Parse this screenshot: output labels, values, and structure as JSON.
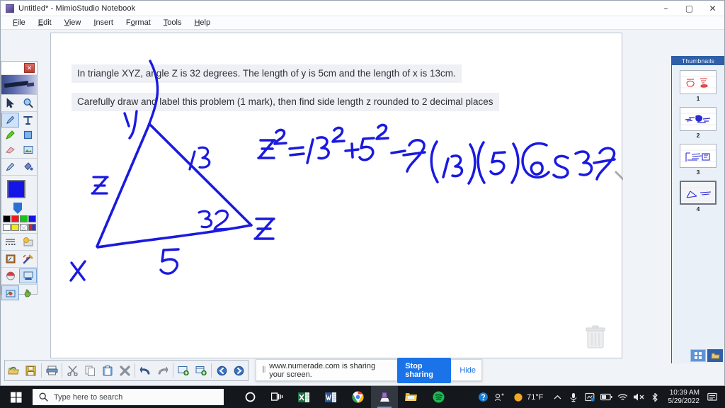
{
  "window": {
    "title": "Untitled* - MimioStudio Notebook",
    "icon": "notebook-icon",
    "controls": {
      "minimize": "–",
      "maximize": "▢",
      "close": "✕"
    }
  },
  "menu": {
    "items": [
      {
        "label": "File",
        "accel": "F"
      },
      {
        "label": "Edit",
        "accel": "E"
      },
      {
        "label": "View",
        "accel": "V"
      },
      {
        "label": "Insert",
        "accel": "I"
      },
      {
        "label": "Format",
        "accel": "o"
      },
      {
        "label": "Tools",
        "accel": "T"
      },
      {
        "label": "Help",
        "accel": "H"
      }
    ]
  },
  "canvas": {
    "prompt_line_1": "In triangle XYZ, angle Z is 32 degrees. The length of y is 5cm and the length of x is 13cm.",
    "prompt_line_2": "Carefully draw and label this problem (1 mark), then find side length z rounded to 2 decimal places",
    "ink_color": "#1a1ae0",
    "annotations": {
      "vertex_top": "Y",
      "vertex_bottom_left": "X",
      "vertex_right": "Z",
      "side_left": "z",
      "side_right": "13",
      "side_bottom": "5",
      "angle": "32",
      "equation": "z² = 13² + 5² - 2(13)(5)Cos 32"
    },
    "trash_icon": "trash-icon"
  },
  "tool_panel": {
    "close_label": "✕",
    "tools": [
      {
        "name": "select-tool",
        "label": "Select",
        "selected": false
      },
      {
        "name": "zoom-tool",
        "label": "Zoom",
        "selected": false
      },
      {
        "name": "pen-tool",
        "label": "Pen",
        "selected": true
      },
      {
        "name": "text-tool",
        "label": "Text",
        "selected": false
      },
      {
        "name": "highlighter-tool",
        "label": "Highlighter",
        "selected": false
      },
      {
        "name": "shape-tool",
        "label": "Shape",
        "selected": false
      },
      {
        "name": "eraser-tool",
        "label": "Eraser",
        "selected": false
      },
      {
        "name": "image-tool",
        "label": "Image",
        "selected": false
      },
      {
        "name": "marker-tool",
        "label": "Marker",
        "selected": false
      },
      {
        "name": "fill-tool",
        "label": "Fill",
        "selected": false
      },
      {
        "name": "gallery-tool",
        "label": "Gallery",
        "selected": false
      },
      {
        "name": "flash-tool",
        "label": "Flash Object",
        "selected": false
      },
      {
        "name": "screen-annotation-tool",
        "label": "Screen Annotation",
        "selected": false
      },
      {
        "name": "spotlight-tool",
        "label": "Spotlight",
        "selected": false
      },
      {
        "name": "reveal-tool",
        "label": "Reveal",
        "selected": false
      },
      {
        "name": "record-tool",
        "label": "Record",
        "selected": true
      },
      {
        "name": "capture-tool",
        "label": "Capture",
        "selected": true
      },
      {
        "name": "gesture-tool",
        "label": "Gesture",
        "selected": false
      }
    ],
    "current_color": "#1414e6",
    "palette_row_1": [
      "#000000",
      "#ee1c1c",
      "#16c416",
      "#1414e6"
    ],
    "palette_row_2": [
      "#ffffff",
      "#f5e71b",
      "transparent",
      "multicolor"
    ]
  },
  "bottom_toolbar": {
    "buttons": [
      {
        "name": "open-button",
        "label": "Open"
      },
      {
        "name": "save-button",
        "label": "Save"
      },
      {
        "name": "print-button",
        "label": "Print"
      },
      {
        "name": "cut-button",
        "label": "Cut"
      },
      {
        "name": "copy-button",
        "label": "Copy"
      },
      {
        "name": "paste-button",
        "label": "Paste"
      },
      {
        "name": "delete-button",
        "label": "Delete"
      },
      {
        "name": "undo-button",
        "label": "Undo"
      },
      {
        "name": "redo-button",
        "label": "Redo"
      },
      {
        "name": "new-page-button",
        "label": "New Page"
      },
      {
        "name": "duplicate-page-button",
        "label": "Duplicate Page"
      },
      {
        "name": "previous-page-button",
        "label": "Previous Page"
      },
      {
        "name": "next-page-button",
        "label": "Next Page"
      }
    ]
  },
  "thumbnails": {
    "header": "Thumbnails",
    "pages": [
      {
        "number": "1",
        "selected": false
      },
      {
        "number": "2",
        "selected": false
      },
      {
        "number": "3",
        "selected": false
      },
      {
        "number": "4",
        "selected": true
      }
    ],
    "view_buttons": [
      {
        "name": "grid-view-button",
        "selected": true
      },
      {
        "name": "folder-view-button",
        "selected": false
      }
    ]
  },
  "share_bar": {
    "grip": "⦀",
    "message": "www.numerade.com is sharing your screen.",
    "stop_label": "Stop sharing",
    "hide_label": "Hide"
  },
  "taskbar": {
    "start_icon": "windows-start-icon",
    "search_placeholder": "Type here to search",
    "apps": [
      {
        "name": "cortana-icon",
        "active": false
      },
      {
        "name": "task-view-icon",
        "active": false
      },
      {
        "name": "excel-icon",
        "active": false
      },
      {
        "name": "word-icon",
        "active": false
      },
      {
        "name": "chrome-icon",
        "active": false
      },
      {
        "name": "mimiostudio-icon",
        "active": true
      },
      {
        "name": "file-explorer-icon",
        "active": false
      },
      {
        "name": "spotify-icon",
        "active": false
      }
    ],
    "tray": {
      "help_icon": "help-circle-icon",
      "people_icon": "people-icon",
      "weather_temp": "71°F",
      "chevron": "⌃",
      "icons": [
        "mic-icon",
        "onedrive-icon",
        "battery-icon",
        "wifi-icon",
        "volume-mute-icon",
        "bluetooth-icon"
      ],
      "time": "10:39 AM",
      "date": "5/29/2022",
      "notification_icon": "notification-icon"
    }
  }
}
